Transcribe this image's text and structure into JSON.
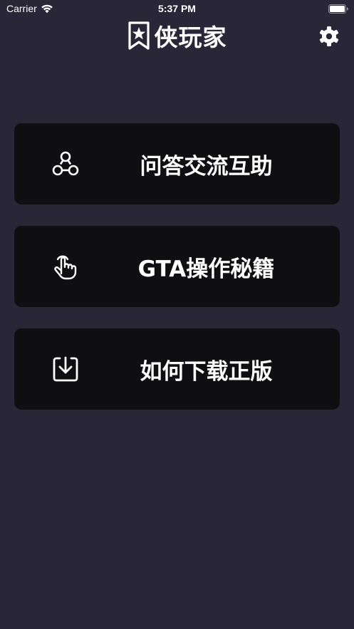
{
  "status_bar": {
    "carrier": "Carrier",
    "time": "5:37 PM"
  },
  "header": {
    "app_name": "侠玩家",
    "logo_icon": "bookmark-star-icon",
    "settings_icon": "gear-icon"
  },
  "menu": {
    "items": [
      {
        "label": "问答交流互助",
        "icon": "community-icon"
      },
      {
        "label": "GTA操作秘籍",
        "icon": "touch-hand-icon"
      },
      {
        "label": "如何下载正版",
        "icon": "download-icon"
      }
    ]
  },
  "colors": {
    "background": "#282637",
    "card": "#0f0f12",
    "text": "#ffffff"
  }
}
